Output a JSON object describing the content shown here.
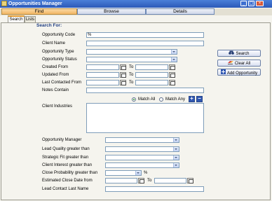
{
  "window": {
    "title": "Opportunities Manager",
    "controls": [
      "_",
      "▢",
      "×"
    ]
  },
  "main_tabs": [
    {
      "label": "Find"
    },
    {
      "label": "Browse"
    },
    {
      "label": "Details"
    }
  ],
  "sub_tabs": [
    {
      "label": "Search"
    },
    {
      "label": "Lists"
    }
  ],
  "search_for_label": "Search For:",
  "fields": {
    "opportunity_code": {
      "label": "Opportunity Code",
      "value": "%"
    },
    "client_name": {
      "label": "Client Name",
      "value": ""
    },
    "opportunity_type": {
      "label": "Opportunity Type",
      "value": ""
    },
    "opportunity_status": {
      "label": "Opportunity Status",
      "value": ""
    },
    "created_from": {
      "label": "Created From",
      "to_label": "To"
    },
    "updated_from": {
      "label": "Updated From",
      "to_label": "To"
    },
    "last_contacted_from": {
      "label": "Last Contacted From",
      "to_label": "To"
    },
    "notes_contain": {
      "label": "Notes Contain",
      "value": ""
    },
    "client_industries": {
      "label": "Client Industries"
    },
    "opportunity_manager": {
      "label": "Opportunity Manager"
    },
    "lead_quality": {
      "label": "Lead Quality greater than"
    },
    "strategic_fit": {
      "label": "Strategic Fit greater than"
    },
    "client_interest": {
      "label": "Client Interest greater than"
    },
    "close_probability": {
      "label": "Close Probability greater than",
      "suffix": "%"
    },
    "estimated_close_date": {
      "label": "Estimated Close Date from",
      "to_label": "To"
    },
    "lead_contact_last_name": {
      "label": "Lead Contact Last Name",
      "value": ""
    }
  },
  "match": {
    "all_label": "Match All",
    "any_label": "Match Any",
    "selected": "all"
  },
  "buttons": {
    "search": "Search",
    "clear_all": "Clear All",
    "add_opportunity": "Add Opportunity",
    "add": "+",
    "remove": "−"
  }
}
